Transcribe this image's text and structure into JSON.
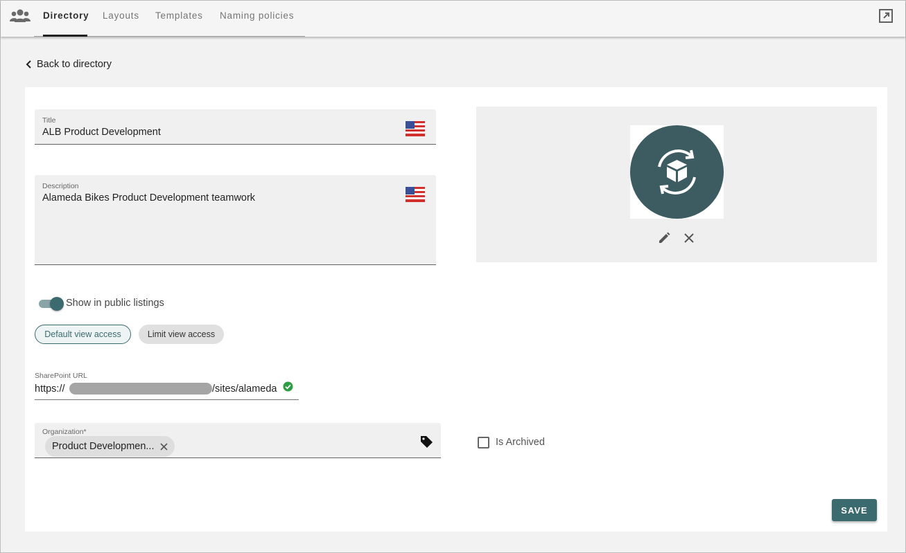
{
  "nav": {
    "app_icon": "people-group-icon",
    "tabs": [
      {
        "label": "Directory",
        "active": true
      },
      {
        "label": "Layouts",
        "active": false
      },
      {
        "label": "Templates",
        "active": false
      },
      {
        "label": "Naming policies",
        "active": false
      }
    ],
    "popout_icon": "open-external-icon"
  },
  "back_link": {
    "label": "Back to directory",
    "icon": "chevron-left-icon"
  },
  "form": {
    "title": {
      "label": "Title",
      "value": "ALB Product Development",
      "flag_icon": "us-flag-icon"
    },
    "description": {
      "label": "Description",
      "value": "Alameda Bikes Product Development teamwork",
      "flag_icon": "us-flag-icon"
    },
    "public_listing": {
      "label": "Show in public listings",
      "enabled": true
    },
    "view_access": {
      "default_label": "Default view access",
      "limit_label": "Limit view access",
      "selected": "Default view access"
    },
    "sharepoint": {
      "label": "SharePoint URL",
      "prefix": "https://",
      "suffix": "/sites/alameda",
      "valid": true
    },
    "organization": {
      "label": "Organization*",
      "chip": "Product Developmen...",
      "tag_icon": "tag-icon"
    },
    "archived": {
      "label": "Is Archived",
      "checked": false
    }
  },
  "image_panel": {
    "icon": "box-refresh-icon",
    "edit_icon": "pencil-icon",
    "remove_icon": "close-icon"
  },
  "actions": {
    "save_label": "SAVE"
  },
  "colors": {
    "accent": "#3c6b6f",
    "success": "#2e9e44",
    "background": "#f2f2f2",
    "card": "#ffffff",
    "field": "#f0f0f0"
  }
}
